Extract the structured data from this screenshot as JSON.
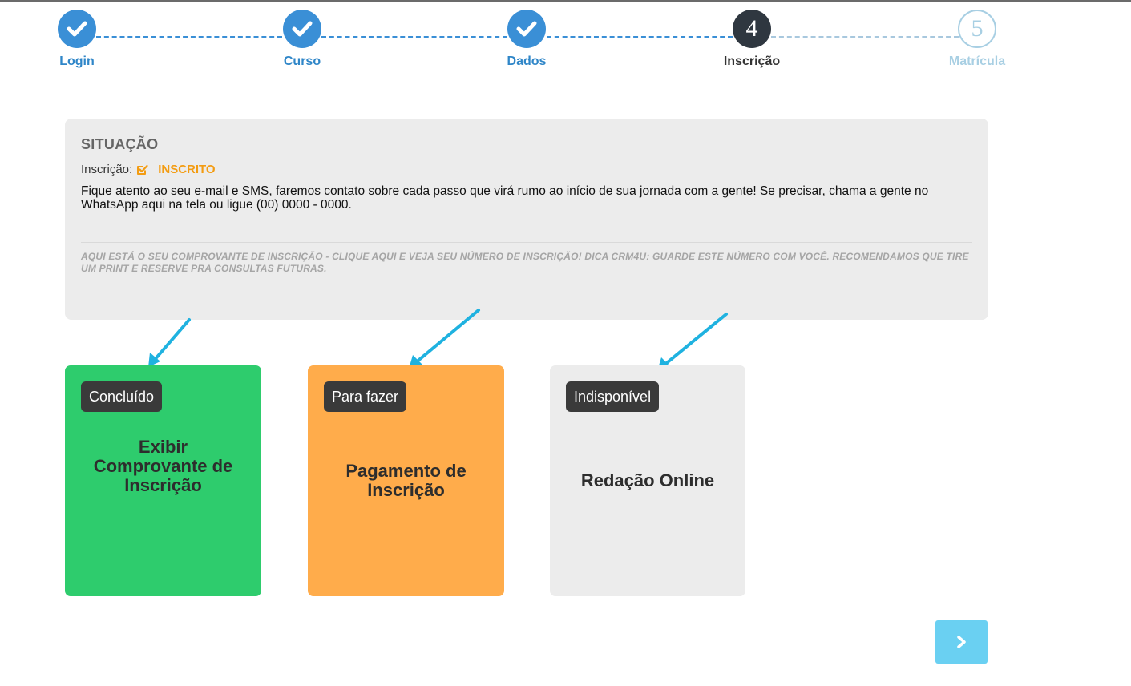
{
  "stepper": {
    "steps": [
      {
        "label": "Login",
        "state": "done"
      },
      {
        "label": "Curso",
        "state": "done"
      },
      {
        "label": "Dados",
        "state": "done"
      },
      {
        "label": "Inscrição",
        "state": "current",
        "number": "4"
      },
      {
        "label": "Matrícula",
        "state": "future",
        "number": "5"
      }
    ]
  },
  "situation": {
    "title": "SITUAÇÃO",
    "status_label": "Inscrição:",
    "status_value": "INSCRITO",
    "message": "Fique atento ao seu e-mail e SMS, faremos contato sobre cada passo que virá rumo ao início de sua jornada com a gente! Se precisar, chama a gente no WhatsApp aqui na tela ou ligue (00) 0000 - 0000.",
    "note": "AQUI ESTÁ O SEU COMPROVANTE DE INSCRIÇÃO - CLIQUE AQUI E VEJA SEU NÚMERO DE INSCRIÇÃO! DICA CRM4U: GUARDE ESTE NÚMERO COM VOCÊ. RECOMENDAMOS QUE TIRE UM PRINT E RESERVE PRA CONSULTAS FUTURAS."
  },
  "cards": [
    {
      "badge": "Concluído",
      "title": "Exibir Comprovante de Inscrição",
      "color": "#2ecc6d"
    },
    {
      "badge": "Para fazer",
      "title": "Pagamento de Inscrição",
      "color": "#ffac4b"
    },
    {
      "badge": "Indisponível",
      "title": "Redação Online",
      "color": "#ececec"
    }
  ],
  "colors": {
    "primary": "#3a8fd6",
    "current_step": "#2f3740",
    "future_step": "#a8cfe3",
    "status_accent": "#f39c12",
    "arrow": "#1fb2e0",
    "next_button": "#6ad0f2"
  },
  "icons": {
    "done_step": "check-icon",
    "status": "checkbox-checked-icon",
    "next": "chevron-right-icon"
  }
}
